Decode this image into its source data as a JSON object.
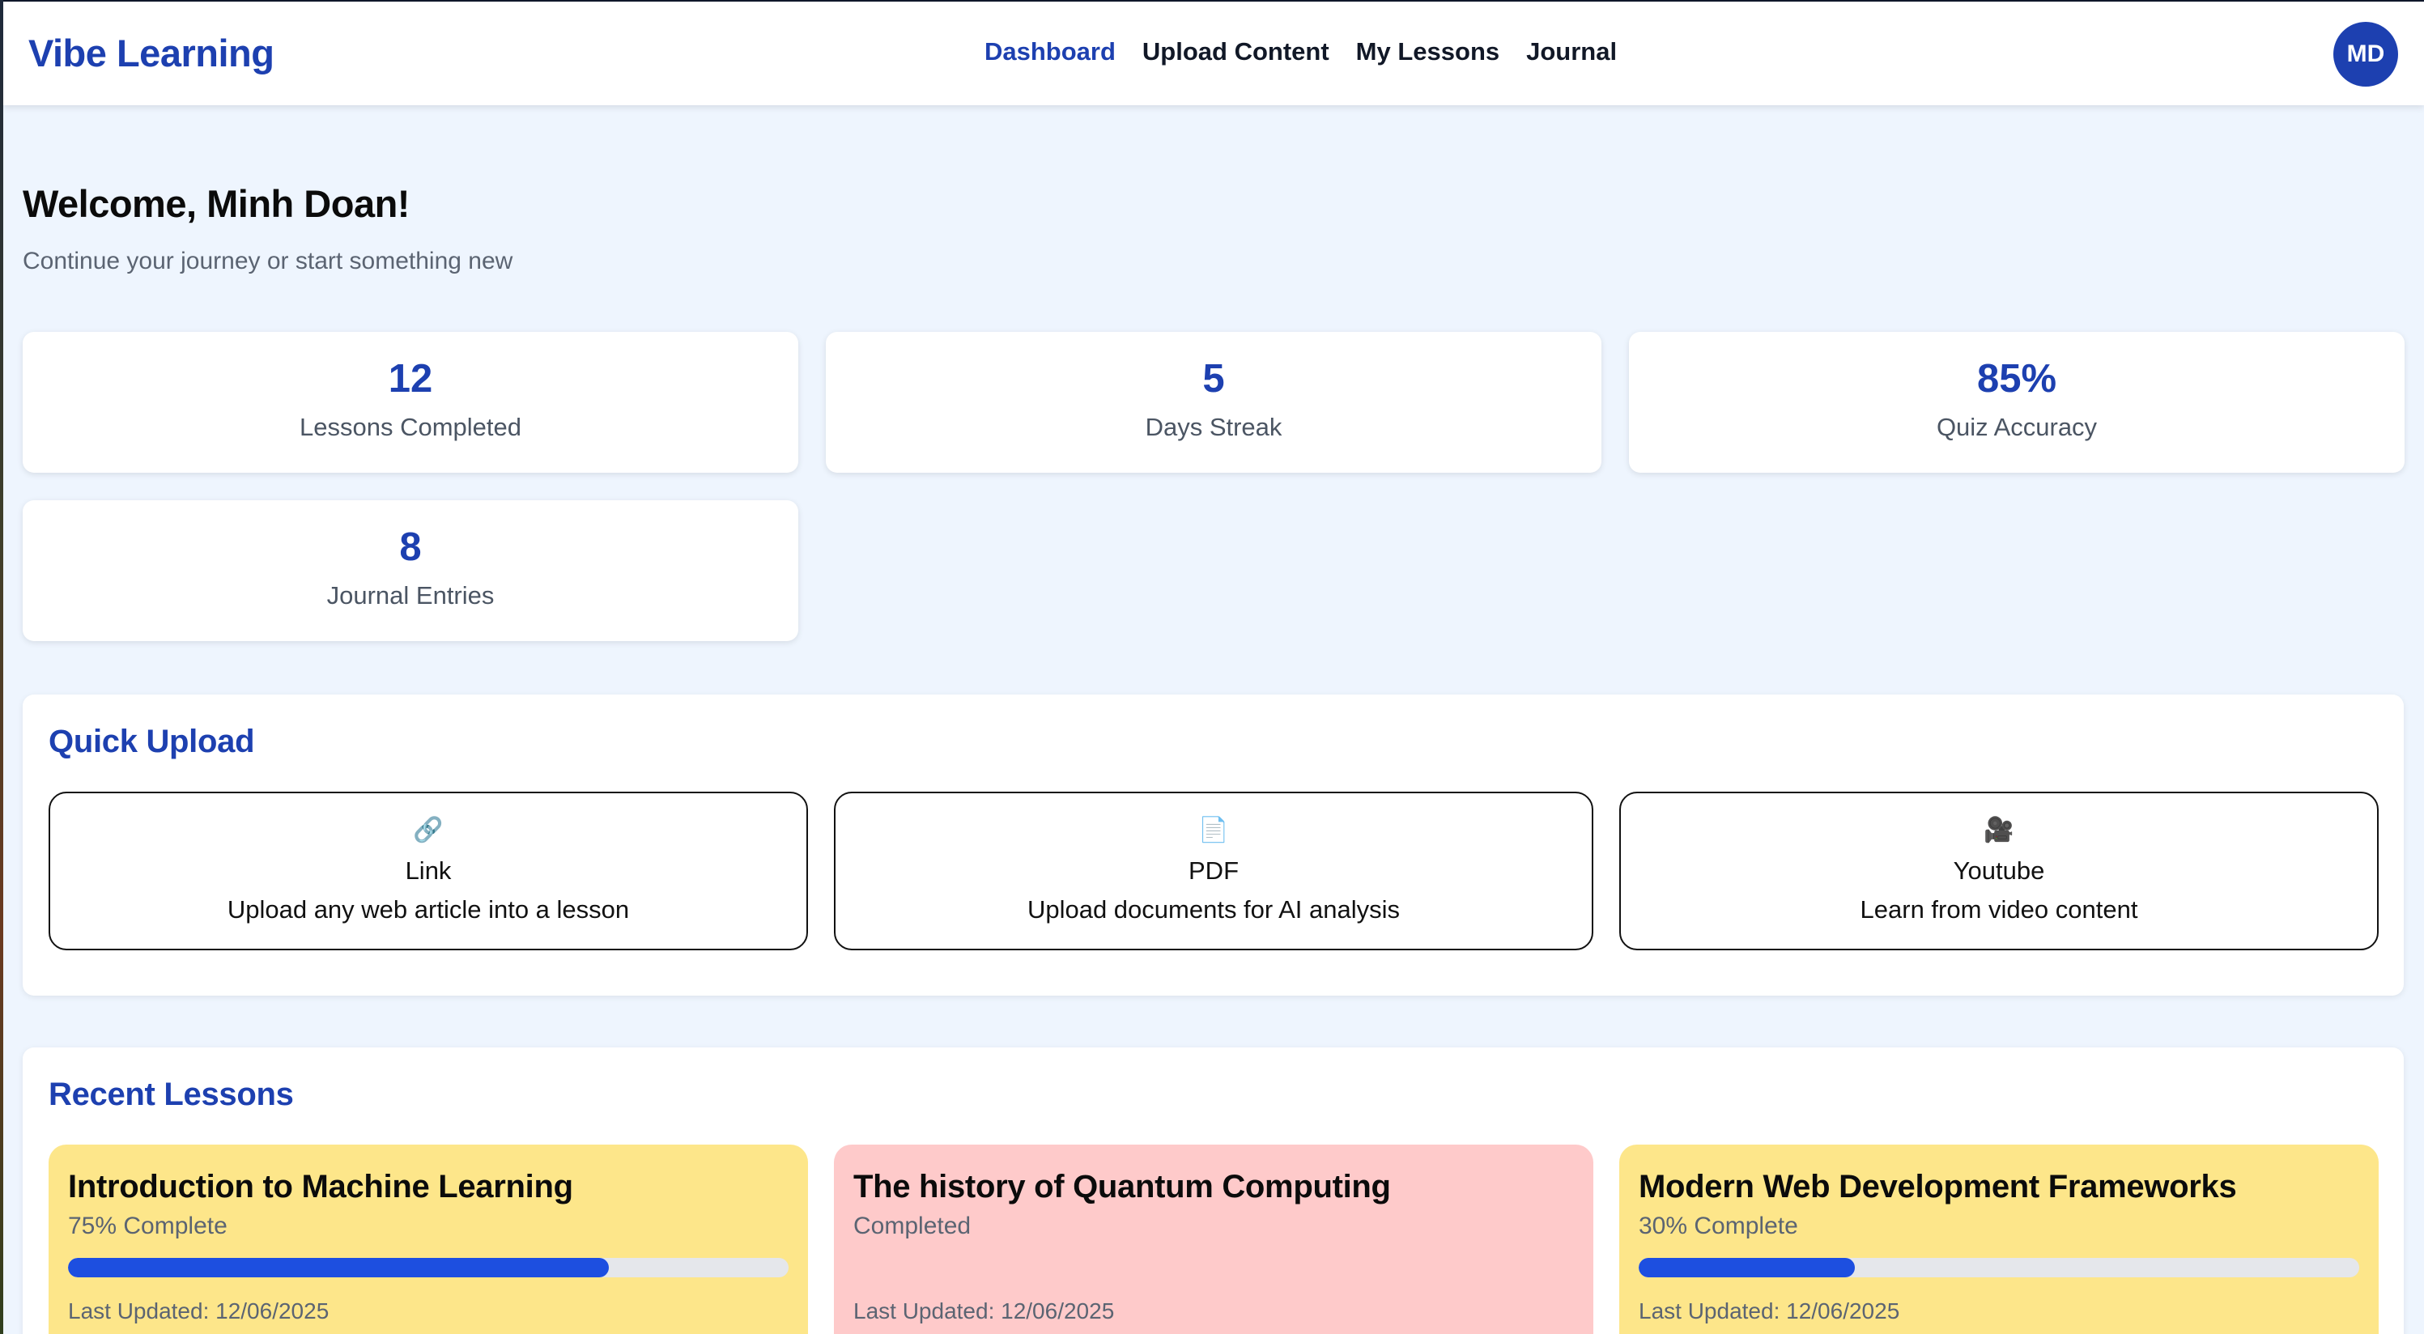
{
  "header": {
    "brand": "Vibe Learning",
    "nav": [
      {
        "label": "Dashboard",
        "active": true
      },
      {
        "label": "Upload Content",
        "active": false
      },
      {
        "label": "My Lessons",
        "active": false
      },
      {
        "label": "Journal",
        "active": false
      }
    ],
    "avatar_initials": "MD"
  },
  "welcome": {
    "title": "Welcome, Minh Doan!",
    "subtitle": "Continue your journey or start something new"
  },
  "stats": [
    {
      "value": "12",
      "label": "Lessons Completed"
    },
    {
      "value": "5",
      "label": "Days Streak"
    },
    {
      "value": "85%",
      "label": "Quiz Accuracy"
    },
    {
      "value": "8",
      "label": "Journal Entries"
    }
  ],
  "quick_upload": {
    "title": "Quick Upload",
    "options": [
      {
        "icon": "link-icon",
        "glyph": "🔗",
        "title": "Link",
        "description": "Upload any web article into a lesson"
      },
      {
        "icon": "document-icon",
        "glyph": "📄",
        "title": "PDF",
        "description": "Upload documents for AI analysis"
      },
      {
        "icon": "video-camera-icon",
        "glyph": "🎥",
        "title": "Youtube",
        "description": "Learn from video content"
      }
    ]
  },
  "recent_lessons": {
    "title": "Recent Lessons",
    "items": [
      {
        "title": "Introduction to Machine Learning",
        "status": "75% Complete",
        "progress": 0.75,
        "updated": "Last Updated: 12/06/2025",
        "color": "#fde68a"
      },
      {
        "title": "The history of Quantum Computing",
        "status": "Completed",
        "progress": null,
        "updated": "Last Updated: 12/06/2025",
        "color": "#fecaca"
      },
      {
        "title": "Modern Web Development Frameworks",
        "status": "30% Complete",
        "progress": 0.3,
        "updated": "Last Updated: 12/06/2025",
        "color": "#fde68a"
      }
    ]
  },
  "colors": {
    "accent": "#1d40b0",
    "page_background": "#eef5fe",
    "progress_fill": "#1d4fe0"
  }
}
